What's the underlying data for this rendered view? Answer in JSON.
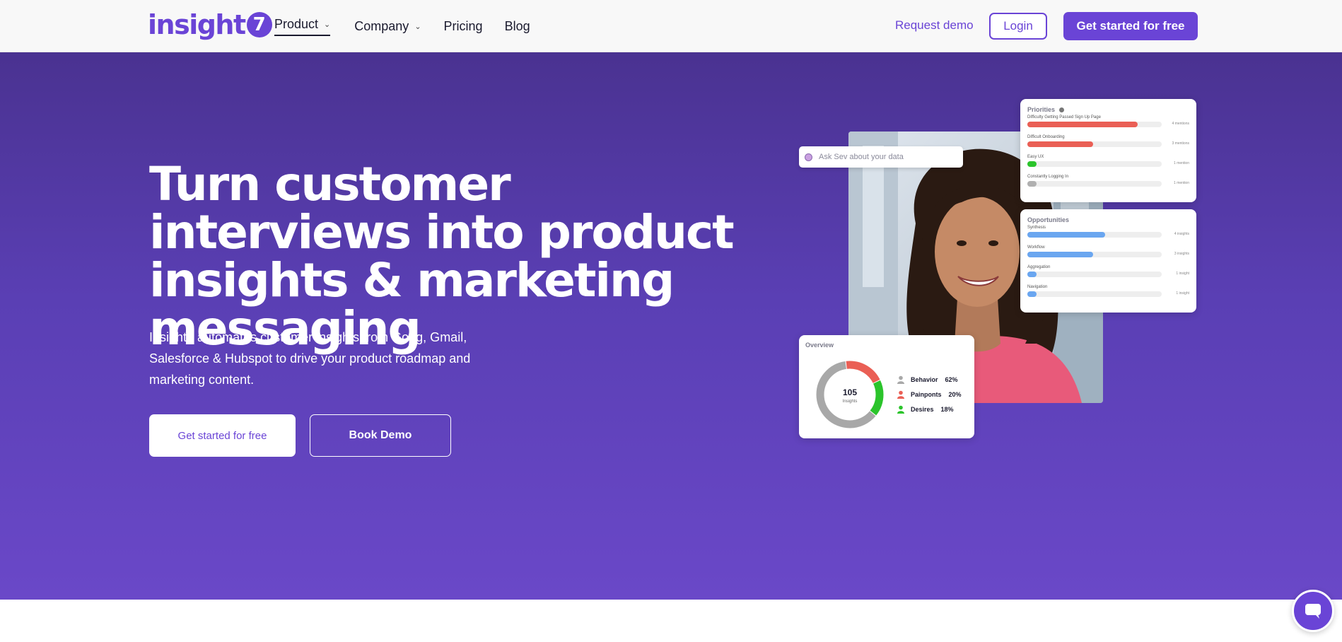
{
  "nav": {
    "logo_text": "insight",
    "logo_badge": "7",
    "links": [
      {
        "label": "Product",
        "has_dropdown": true,
        "active": true
      },
      {
        "label": "Company",
        "has_dropdown": true
      },
      {
        "label": "Pricing"
      },
      {
        "label": "Blog"
      }
    ],
    "request_demo": "Request demo",
    "login": "Login",
    "get_started": "Get started for free"
  },
  "hero": {
    "headline": "Turn customer interviews into product insights & marketing messaging",
    "subtitle": "Insight7 automates customer insights from Gong, Gmail, Salesforce & Hubspot to drive your product roadmap and marketing content.",
    "primary_cta": "Get started for free",
    "secondary_cta": "Book Demo"
  },
  "visual": {
    "ask_placeholder": "Ask Sev about your data",
    "priorities": {
      "title": "Priorities",
      "items": [
        {
          "label": "Difficulty Getting Passed Sign Up Page",
          "count": "4 mentions",
          "fill": 0.82,
          "color": "#ea5f55"
        },
        {
          "label": "Difficult Onboarding",
          "count": "3 mentions",
          "fill": 0.49,
          "color": "#ea5f55"
        },
        {
          "label": "Easy UX",
          "count": "1 mention",
          "fill": 0.07,
          "color": "#2bc42b"
        },
        {
          "label": "Constantly Logging In",
          "count": "1 mention",
          "fill": 0.07,
          "color": "#b0b0b0"
        }
      ]
    },
    "opportunities": {
      "title": "Opportunities",
      "items": [
        {
          "label": "Synthesis",
          "count": "4 insights",
          "fill": 0.58,
          "color": "#6aa6f0"
        },
        {
          "label": "Workflow",
          "count": "3 insights",
          "fill": 0.49,
          "color": "#6aa6f0"
        },
        {
          "label": "Aggregation",
          "count": "1 insight",
          "fill": 0.07,
          "color": "#6aa6f0"
        },
        {
          "label": "Navigation",
          "count": "1 insight",
          "fill": 0.07,
          "color": "#6aa6f0"
        }
      ]
    },
    "overview": {
      "title": "Overview",
      "total": "105",
      "total_label": "Insights",
      "segments": [
        {
          "label": "Behavior",
          "pct": "62%",
          "value": 62,
          "color": "#a8a8a8"
        },
        {
          "label": "Painponts",
          "pct": "20%",
          "value": 20,
          "color": "#ea5f55"
        },
        {
          "label": "Desires",
          "pct": "18%",
          "value": 18,
          "color": "#2bc42b"
        }
      ]
    }
  },
  "colors": {
    "brand": "#6a44d6",
    "hero_top": "#4a3291",
    "hero_bottom": "#6a48c8"
  }
}
